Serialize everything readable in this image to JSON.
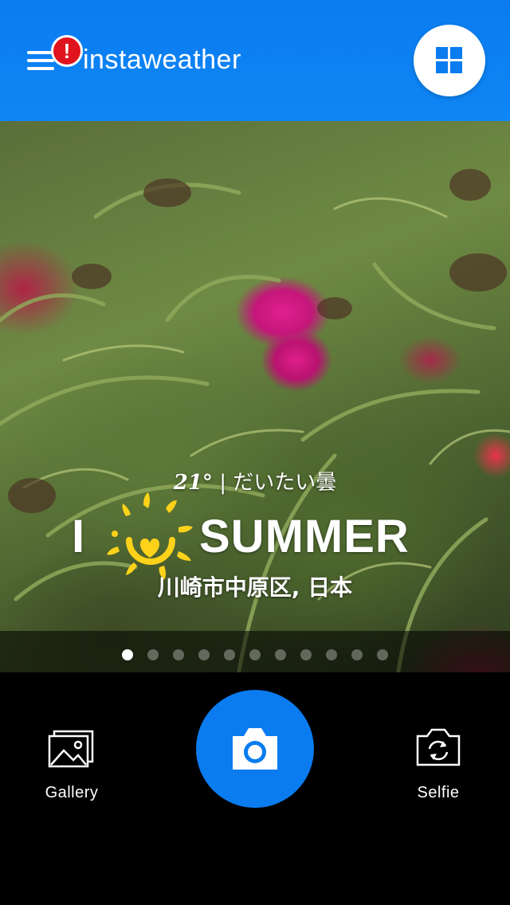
{
  "header": {
    "app_title": "instaweather",
    "alert_badge": "!",
    "menu_icon": "hamburger-menu-icon",
    "grid_icon": "grid-four-squares-icon",
    "accent_color": "#0a7cf0"
  },
  "overlay": {
    "temperature": "21°",
    "separator": "|",
    "condition": "だいたい曇",
    "summer_i": "I",
    "summer_word": "SUMMER",
    "sun_icon": "sun-heart-icon",
    "location": "川崎市中原区, 日本"
  },
  "pager": {
    "page_count": 11,
    "active_index": 0
  },
  "bottom": {
    "gallery_label": "Gallery",
    "gallery_icon": "gallery-images-icon",
    "shutter_icon": "camera-icon",
    "selfie_label": "Selfie",
    "selfie_icon": "switch-camera-icon"
  }
}
